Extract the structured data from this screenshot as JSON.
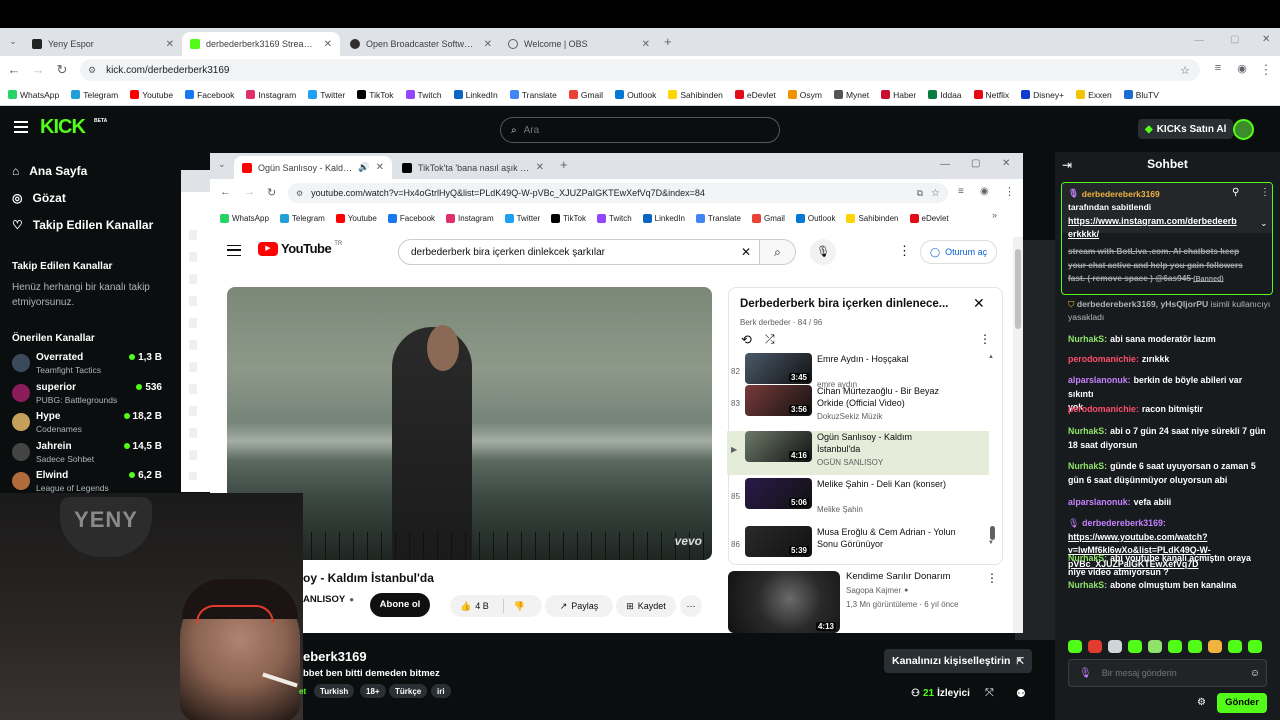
{
  "browser": {
    "tabs": [
      {
        "title": "Yeny Espor",
        "color": "#222222"
      },
      {
        "title": "derbederberk3169 Stream - W",
        "color": "#53fc18"
      },
      {
        "title": "Open Broadcaster Software | OB",
        "color": "#302e31"
      },
      {
        "title": "Welcome | OBS",
        "color": "#5f6368"
      }
    ],
    "url": "kick.com/derbederberk3169",
    "bookmarks": [
      {
        "label": "WhatsApp",
        "color": "#25d366"
      },
      {
        "label": "Telegram",
        "color": "#229ed9"
      },
      {
        "label": "Youtube",
        "color": "#ff0000"
      },
      {
        "label": "Facebook",
        "color": "#1877f2"
      },
      {
        "label": "Instagram",
        "color": "#e1306c"
      },
      {
        "label": "Twitter",
        "color": "#1da1f2"
      },
      {
        "label": "TikTok",
        "color": "#000000"
      },
      {
        "label": "Twitch",
        "color": "#9146ff"
      },
      {
        "label": "LinkedIn",
        "color": "#0a66c2"
      },
      {
        "label": "Translate",
        "color": "#4285f4"
      },
      {
        "label": "Gmail",
        "color": "#ea4335"
      },
      {
        "label": "Outlook",
        "color": "#0078d4"
      },
      {
        "label": "Sahibinden",
        "color": "#ffd400"
      },
      {
        "label": "eDevlet",
        "color": "#e30a17"
      },
      {
        "label": "Osym",
        "color": "#f39200"
      },
      {
        "label": "Mynet",
        "color": "#555555"
      },
      {
        "label": "Haber",
        "color": "#c8102e"
      },
      {
        "label": "Iddaa",
        "color": "#0a7b3e"
      },
      {
        "label": "Netflix",
        "color": "#e50914"
      },
      {
        "label": "Disney+",
        "color": "#113ccf"
      },
      {
        "label": "Exxen",
        "color": "#f5c400"
      },
      {
        "label": "BluTV",
        "color": "#1c6dd0"
      }
    ]
  },
  "kick": {
    "logo": "KICK",
    "beta": "BETA",
    "search_placeholder": "Ara",
    "buy_kicks": "KICKs Satın Al",
    "nav": [
      {
        "label": "Ana Sayfa",
        "icon": "home-icon"
      },
      {
        "label": "Gözat",
        "icon": "compass-icon"
      },
      {
        "label": "Takip Edilen Kanallar",
        "icon": "heart-icon"
      }
    ],
    "followed_title": "Takip Edilen Kanallar",
    "followed_empty": "Henüz herhangi bir kanalı takip etmiyorsunuz.",
    "recommended_title": "Önerilen Kanallar",
    "channels": [
      {
        "name": "Overrated",
        "category": "Teamfight Tactics",
        "viewers": "1,3 B",
        "color": "#3a4a5c"
      },
      {
        "name": "superior",
        "category": "PUBG: Battlegrounds",
        "viewers": "536",
        "color": "#8a1c5a"
      },
      {
        "name": "Hype",
        "category": "Codenames",
        "viewers": "18,2 B",
        "color": "#c4a05a"
      },
      {
        "name": "Jahrein",
        "category": "Sadece Sohbet",
        "viewers": "14,5 B",
        "color": "#444444"
      },
      {
        "name": "Elwind",
        "category": "League of Legends",
        "viewers": "6,2 B",
        "color": "#b06a3c"
      }
    ],
    "stream_title_partial": "eberk3169",
    "stream_subtitle": "bbet ben bitti demeden bitmez",
    "tags": [
      "et",
      "Turkish",
      "18+",
      "Türkçe",
      "iri"
    ],
    "customize_btn": "Kanalınızı kişiselleştirin",
    "viewers": "21",
    "viewers_label": "İzleyici",
    "webcam_logo": "YENY"
  },
  "chat": {
    "title": "Sohbet",
    "pinned": {
      "user": "derbedereberk3169",
      "text": "tarafından sabitlendi",
      "link": "https://www.instagram.com/derbedererkkkk/"
    },
    "pinned_link_lines": [
      "https://www.instagram.com/derbedeerb",
      "erkkkk/"
    ],
    "banned_lines": [
      "stream with BotLiva .com. AI chatbots keep",
      "your chat active and help you gain followers",
      "fast. ( remove space ) @6as945"
    ],
    "banned_tag": "(Banned)",
    "mod_notice": {
      "user": "derbedereberk3169, yHsQljorPU",
      "text": "isimli kullanıcıyı yasakladı"
    },
    "messages": [
      {
        "user": "NurhakS:",
        "color": "#8fe36a",
        "lines": [
          "abi sana moderatör lazım"
        ]
      },
      {
        "user": "perodomanichie:",
        "color": "#ff4d6d",
        "lines": [
          "zırıkkk"
        ]
      },
      {
        "user": "alparslanonuk:",
        "color": "#c780ff",
        "lines": [
          "berkin de böyle abileri var sıkıntı",
          "yok"
        ]
      },
      {
        "user": "perodomanichie:",
        "color": "#ff4d6d",
        "lines": [
          "racon bitmiştir"
        ]
      },
      {
        "user": "NurhakS:",
        "color": "#8fe36a",
        "lines": [
          "abi o 7 gün 24 saat niye sürekli 7 gün",
          "18 saat diyorsun"
        ]
      },
      {
        "user": "NurhakS:",
        "color": "#8fe36a",
        "lines": [
          "günde 6 saat uyuyorsan o zaman 5",
          "gün 6 saat düşünmüyor oluyorsun abi"
        ]
      },
      {
        "user": "alparslanonuk:",
        "color": "#c780ff",
        "lines": [
          "vefa abiii"
        ]
      },
      {
        "user": "derbedereberk3169:",
        "color": "#c780ff",
        "lines": [
          "https://www.youtube.com/watch?",
          "v=lwMf6kl6wXo&list=PLdK49Q-W-",
          "pVBc_XJUZPaIGKTEwXefVq7D"
        ]
      },
      {
        "user": "NurhakS:",
        "color": "#8fe36a",
        "lines": [
          "abi youtube kanalı açmıştın oraya",
          "niye video atmıyorsun ?"
        ]
      },
      {
        "user": "NurhakS:",
        "color": "#8fe36a",
        "lines": [
          "abone olmuştum ben kanalına"
        ]
      }
    ],
    "input_placeholder": "Bir mesaj gönderin",
    "send": "Gönder"
  },
  "inner": {
    "tabs": [
      {
        "title": "Ogün Sanlısoy - Kaldım İsta",
        "color": "#ff0000"
      },
      {
        "title": "TikTok'ta 'bana nasıl aşık oldu t",
        "color": "#000000"
      }
    ],
    "url": "youtube.com/watch?v=Hx4oGtrlHyQ&list=PLdK49Q-W-pVBc_XJUZPaIGKTEwXefVq7D&index=84",
    "bookmarks": [
      "WhatsApp",
      "Telegram",
      "Youtube",
      "Facebook",
      "Instagram",
      "Twitter",
      "TikTok",
      "Twitch",
      "LinkedIn",
      "Translate",
      "Gmail",
      "Outlook",
      "Sahibinden",
      "eDevlet"
    ],
    "bookmark_colors": [
      "#25d366",
      "#229ed9",
      "#ff0000",
      "#1877f2",
      "#e1306c",
      "#1da1f2",
      "#000000",
      "#9146ff",
      "#0a66c2",
      "#4285f4",
      "#ea4335",
      "#0078d4",
      "#ffd400",
      "#e30a17"
    ]
  },
  "youtube": {
    "logo": "YouTube",
    "region": "TR",
    "search_value": "derbederberk bira içerken dinlekcek şarkılar",
    "signin": "Oturum aç",
    "video_title_partial": "oy - Kaldım İstanbul'da",
    "channel_partial": "ANLISOY",
    "subscribe": "Abone ol",
    "likes": "4 B",
    "share": "Paylaş",
    "save": "Kaydet",
    "vevo": "vevo",
    "playlist_title": "Derbederberk bira içerken dinlenece...",
    "playlist_meta": "Berk derbeder · 84 / 96",
    "playlist": [
      {
        "num": "82",
        "title": "Emre Aydın - Hoşçakal",
        "channel": "emre aydın",
        "duration": "3:45",
        "color": "#4a5a6a",
        "current": false
      },
      {
        "num": "83",
        "title": "Cihan Mürtezaoğlu - Bir Beyaz Orkide (Official Video)",
        "channel": "DokuzSekiz Müzik",
        "duration": "3:56",
        "color": "#7a3b3b",
        "current": false
      },
      {
        "num": "▶",
        "title": "Ogün Sanlısoy - Kaldım İstanbul'da",
        "channel": "OGÜN SANLISOY",
        "duration": "4:16",
        "color": "#6d7a6a",
        "current": true
      },
      {
        "num": "85",
        "title": "Melike Şahin - Deli Kan (konser)",
        "channel": "Melike Şahin",
        "duration": "5:06",
        "color": "#2a1a4a",
        "current": false
      },
      {
        "num": "86",
        "title": "Musa Eroğlu & Cem Adrian - Yolun Sonu Görünüyor",
        "channel": "",
        "duration": "5:39",
        "color": "#2a2a2a",
        "current": false
      }
    ],
    "recommended": {
      "title": "Kendime Sarılır Donarım",
      "channel": "Sagopa Kajmer",
      "stats": "1,3 Mn görüntüleme · 6 yıl önce",
      "duration": "4:13"
    }
  }
}
